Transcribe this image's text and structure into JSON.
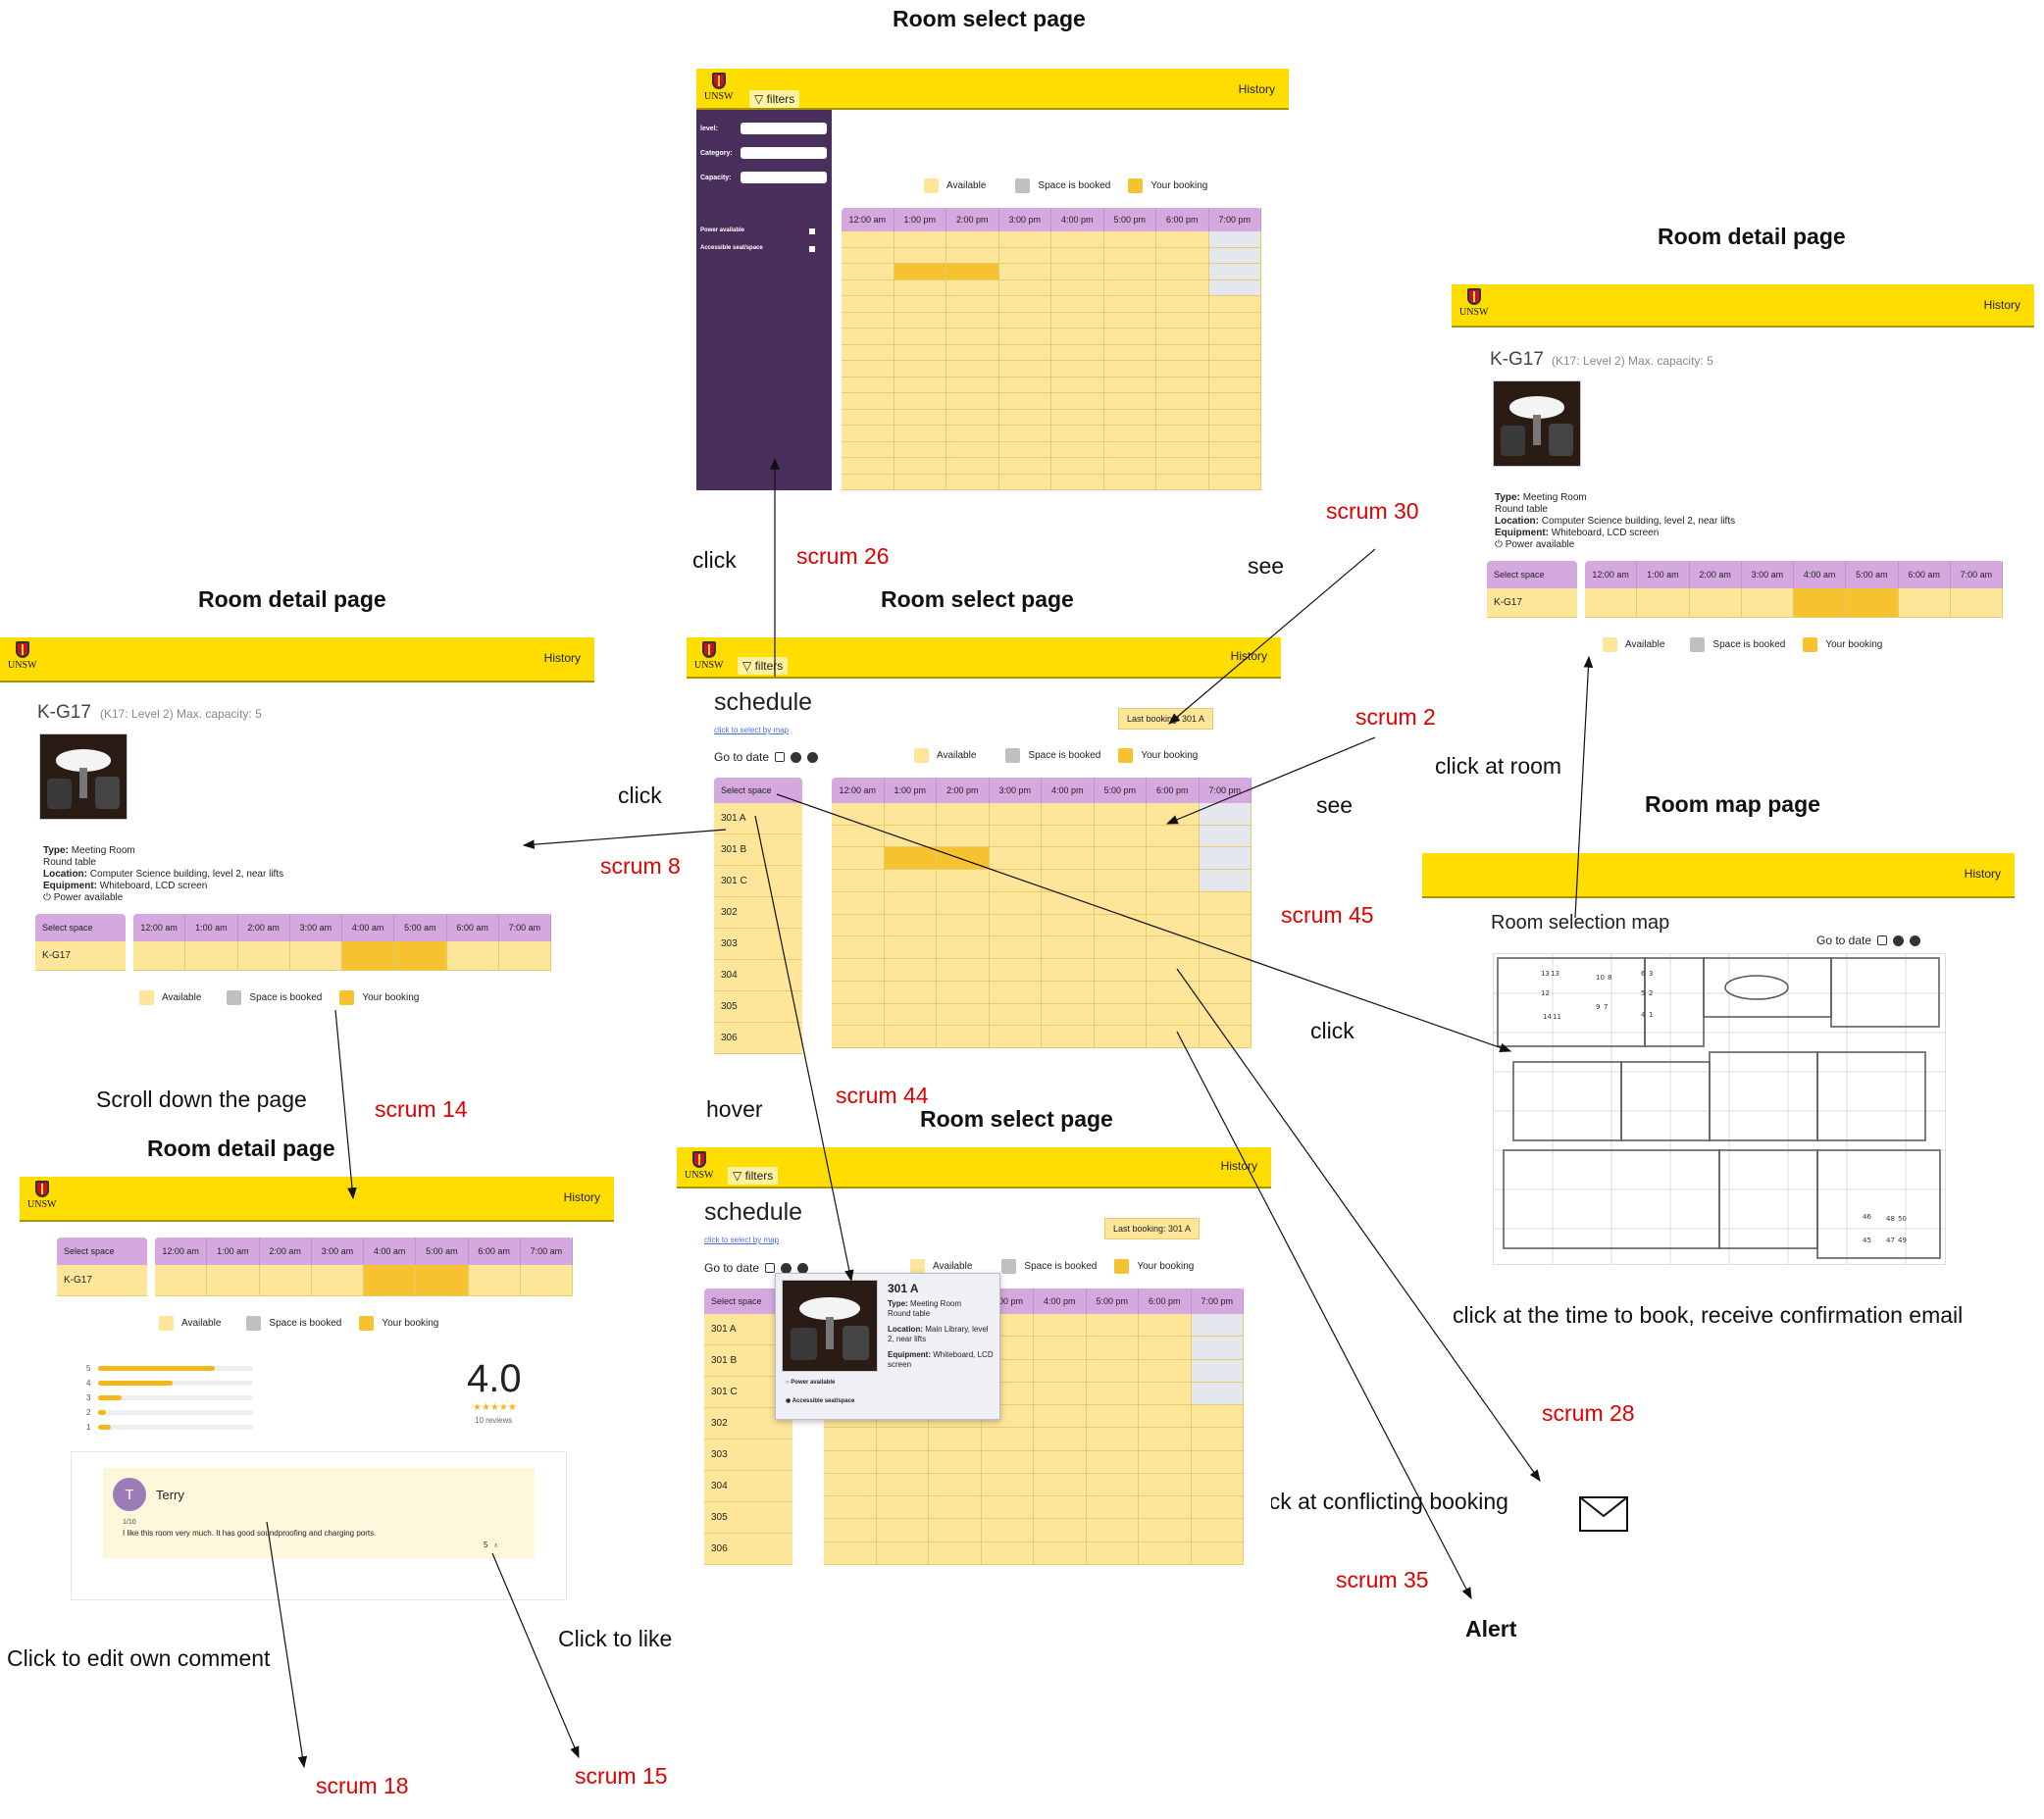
{
  "section_titles": {
    "room_select_1": "Room select page",
    "room_detail_1": "Room detail page",
    "room_select_2": "Room select page",
    "room_detail_2": "Room detail page",
    "room_map": "Room map page",
    "room_detail_3": "Room detail page",
    "room_select_3": "Room select page",
    "alert": "Alert"
  },
  "annotations": {
    "click_1": "click",
    "see_1": "see",
    "click_2": "click",
    "see_2": "see",
    "click_at_room": "click at room",
    "click_3": "click",
    "scroll_down": "Scroll down the page",
    "hover": "hover",
    "click_to_book": "click at the time to book, receive confirmation email",
    "click_conflicting": "click at conflicting booking",
    "click_edit_comment": "Click to edit own comment",
    "click_to_like": "Click to like"
  },
  "scrum_labels": {
    "s26": "scrum 26",
    "s30": "scrum 30",
    "s2": "scrum 2",
    "s8": "scrum 8",
    "s45": "scrum 45",
    "s14": "scrum 14",
    "s44": "scrum 44",
    "s28": "scrum 28",
    "s35": "scrum 35",
    "s18": "scrum 18",
    "s15": "scrum 15"
  },
  "common": {
    "logo_text": "UNSW",
    "history": "History",
    "filters": "filters",
    "schedule": "schedule",
    "select_by_map": "click to select by map",
    "go_to_date": "Go to date",
    "last_booking": "Last booking: 301 A",
    "select_space": "Select space",
    "legend": {
      "available": "Available",
      "booked": "Space is booked",
      "yours": "Your booking"
    },
    "legend_colors": {
      "available": "#fde59a",
      "booked": "#c0c0c0",
      "yours": "#f7c230"
    },
    "accent_bar": "#ffdd00",
    "sidebar_color": "#4a2f5d",
    "header_color": "#d6a8e0"
  },
  "filter_panel": {
    "level": "level:",
    "category": "Category:",
    "capacity": "Capacity:",
    "power": "Power available",
    "accessible": "Accessible seat/space"
  },
  "times_pm": [
    "12:00 am",
    "1:00 pm",
    "2:00 pm",
    "3:00 pm",
    "4:00 pm",
    "5:00 pm",
    "6:00 pm",
    "7:00 pm"
  ],
  "times_am": [
    "12:00 am",
    "1:00 am",
    "2:00 am",
    "3:00 am",
    "4:00 am",
    "5:00 am",
    "6:00 am",
    "7:00 am"
  ],
  "rooms": [
    "301 A",
    "301 B",
    "301 C",
    "302",
    "303",
    "304",
    "305",
    "306"
  ],
  "room_detail": {
    "name": "K-G17",
    "sub": "(K17: Level 2) Max. capacity: 5",
    "type_label": "Type:",
    "type_value": "Meeting Room",
    "type_extra": "Round table",
    "location_label": "Location:",
    "location_value": "Computer Science building, level 2, near lifts",
    "equipment_label": "Equipment:",
    "equipment_value": "Whiteboard, LCD screen",
    "power": "Power available",
    "select_item": "K-G17"
  },
  "rating": {
    "score": "4.0",
    "stars": "★★★★★",
    "reviews": "10 reviews",
    "levels": [
      "5",
      "4",
      "3",
      "2",
      "1"
    ],
    "fractions": [
      0.75,
      0.48,
      0.15,
      0.05,
      0.08
    ]
  },
  "comment": {
    "initial": "T",
    "author": "Terry",
    "date": "1/10",
    "text": "I like this room very much. It has good soundproofing and charging ports.",
    "likes": "5",
    "like_icon": "👍"
  },
  "map": {
    "title": "Room selection map",
    "go_to_date": "Go to date",
    "labels": [
      "13",
      "13",
      "10",
      "8",
      "12",
      "5",
      "2",
      "14",
      "11",
      "9",
      "7",
      "4",
      "1",
      "6",
      "3",
      "46",
      "48",
      "50",
      "45",
      "47",
      "49"
    ]
  },
  "popup": {
    "room": "301 A",
    "type_label": "Type:",
    "type_value": "Meeting Room",
    "type_extra": "Round table",
    "location_label": "Location:",
    "location_value": "Main Library, level 2, near lifts",
    "equipment_label": "Equipment:",
    "equipment_value": "Whiteboard, LCD screen",
    "power": "Power available",
    "accessible": "Accessible seat/space"
  }
}
